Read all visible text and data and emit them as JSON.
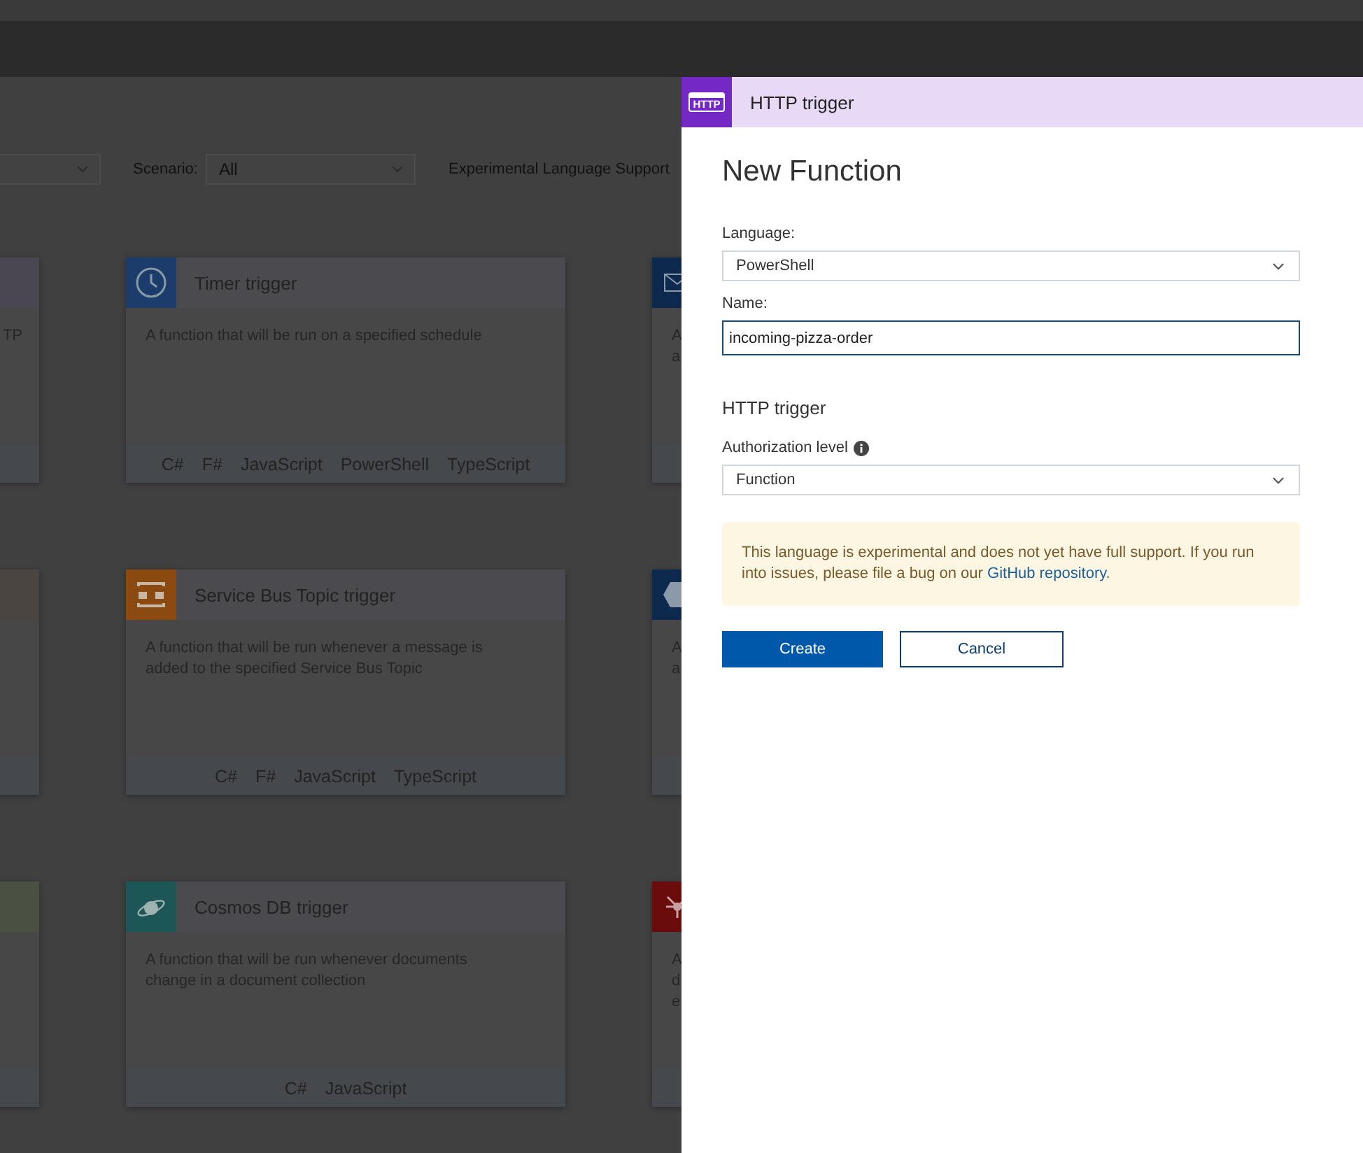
{
  "filters": {
    "scenario_label": "Scenario:",
    "scenario_value": "All",
    "experimental_label": "Experimental Language Support"
  },
  "templates": [
    {
      "kind": "none",
      "color": "#4b4750",
      "description": [
        "TP"
      ]
    },
    {
      "kind": "clock",
      "color": "#1c3d6b",
      "title": "Timer trigger",
      "description": [
        "A function that will be run on a specified schedule"
      ],
      "languages": [
        "C#",
        "F#",
        "JavaScript",
        "PowerShell",
        "TypeScript"
      ]
    },
    {
      "kind": "mail",
      "color": "#0d2a4e",
      "description": [
        "A",
        "a"
      ]
    },
    {
      "kind": "none",
      "color": "#4a4540"
    },
    {
      "kind": "bus",
      "color": "#8a4a10",
      "title": "Service Bus Topic trigger",
      "description": [
        "A function that will be run whenever a message is",
        "added to the specified Service Bus Topic"
      ],
      "languages": [
        "C#",
        "F#",
        "JavaScript",
        "TypeScript"
      ]
    },
    {
      "kind": "hexagon",
      "color": "#0d2a4e",
      "description": [
        "A",
        "a"
      ]
    },
    {
      "kind": "none",
      "color": "#4a5142"
    },
    {
      "kind": "planet",
      "color": "#1d5656",
      "title": "Cosmos DB trigger",
      "description": [
        "A function that will be run whenever documents",
        "change in a document collection"
      ],
      "languages": [
        "C#",
        "JavaScript"
      ]
    },
    {
      "kind": "network",
      "color": "#6a0c0c",
      "description": [
        "A",
        "d",
        "e"
      ]
    }
  ],
  "panel": {
    "header_icon": "HTTP",
    "header_title": "HTTP trigger",
    "heading": "New Function",
    "language_label": "Language:",
    "language_value": "PowerShell",
    "name_label": "Name:",
    "name_value": "incoming-pizza-order",
    "section_title": "HTTP trigger",
    "auth_label": "Authorization level",
    "auth_value": "Function",
    "notice": {
      "text": "This language is experimental and does not yet have full support. If you run into issues, please file a bug on our ",
      "link": "GitHub repository",
      "after": "."
    },
    "buttons": [
      {
        "kind": "primary",
        "label": "Create"
      },
      {
        "kind": "secondary",
        "label": "Cancel"
      }
    ]
  }
}
